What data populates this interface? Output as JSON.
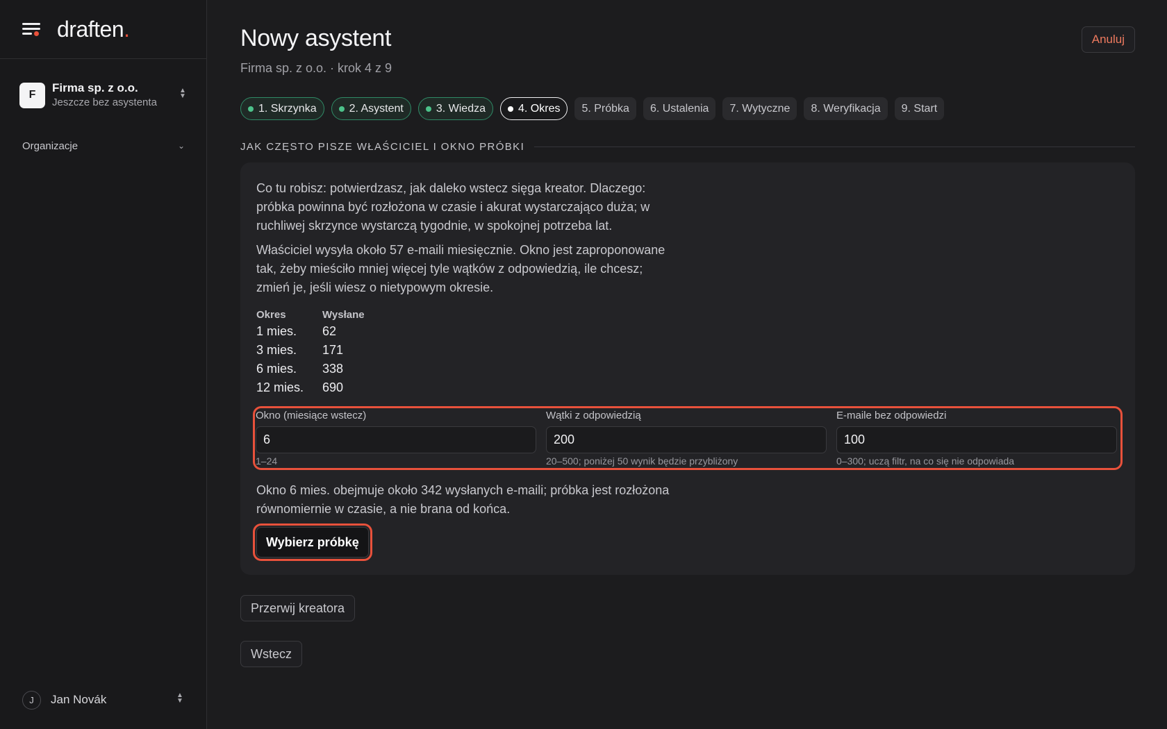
{
  "sidebar": {
    "logo_text": "draften",
    "logo_dot": ".",
    "org": {
      "avatar_letter": "F",
      "name": "Firma sp. z o.o.",
      "subtitle": "Jeszcze bez asystenta"
    },
    "nav_group": "Organizacje",
    "user": {
      "avatar_letter": "J",
      "name": "Jan Novák"
    }
  },
  "header": {
    "title": "Nowy asystent",
    "subtitle": "Firma sp. z o.o. · krok 4 z 9",
    "cancel_label": "Anuluj"
  },
  "steps": [
    {
      "label": "1. Skrzynka",
      "state": "done"
    },
    {
      "label": "2. Asystent",
      "state": "done"
    },
    {
      "label": "3. Wiedza",
      "state": "done"
    },
    {
      "label": "4. Okres",
      "state": "current"
    },
    {
      "label": "5. Próbka",
      "state": "todo"
    },
    {
      "label": "6. Ustalenia",
      "state": "todo"
    },
    {
      "label": "7. Wytyczne",
      "state": "todo"
    },
    {
      "label": "8. Weryfikacja",
      "state": "todo"
    },
    {
      "label": "9. Start",
      "state": "todo"
    }
  ],
  "section": {
    "title": "JAK CZĘSTO PISZE WŁAŚCICIEL I OKNO PRÓBKI",
    "intro": "Co tu robisz: potwierdzasz, jak daleko wstecz sięga kreator. Dlaczego: próbka powinna być rozłożona w czasie i akurat wystarczająco duża; w ruchliwej skrzynce wystarczą tygodnie, w spokojnej potrzeba lat.",
    "info": "Właściciel wysyła około 57 e-maili miesięcznie. Okno jest zaproponowane tak, żeby mieściło mniej więcej tyle wątków z odpowiedzią, ile chcesz; zmień je, jeśli wiesz o nietypowym okresie.",
    "table": {
      "headers": [
        "Okres",
        "Wysłane"
      ],
      "rows": [
        [
          "1 mies.",
          "62"
        ],
        [
          "3 mies.",
          "171"
        ],
        [
          "6 mies.",
          "338"
        ],
        [
          "12 mies.",
          "690"
        ]
      ]
    },
    "fields": [
      {
        "label": "Okno (miesiące wstecz)",
        "value": "6",
        "hint": "1–24"
      },
      {
        "label": "Wątki z odpowiedzią",
        "value": "200",
        "hint": "20–500; poniżej 50 wynik będzie przybliżony"
      },
      {
        "label": "E-maile bez odpowiedzi",
        "value": "100",
        "hint": "0–300; uczą filtr, na co się nie odpowiada"
      }
    ],
    "summary": "Okno 6 mies. obejmuje około 342 wysłanych e-maili; próbka jest rozłożona równomiernie w czasie, a nie brana od końca.",
    "pick_label": "Wybierz próbkę"
  },
  "actions": {
    "abort_label": "Przerwij kreatora",
    "back_label": "Wstecz"
  },
  "colors": {
    "accent": "#e8513b",
    "done": "#4cc28a"
  }
}
